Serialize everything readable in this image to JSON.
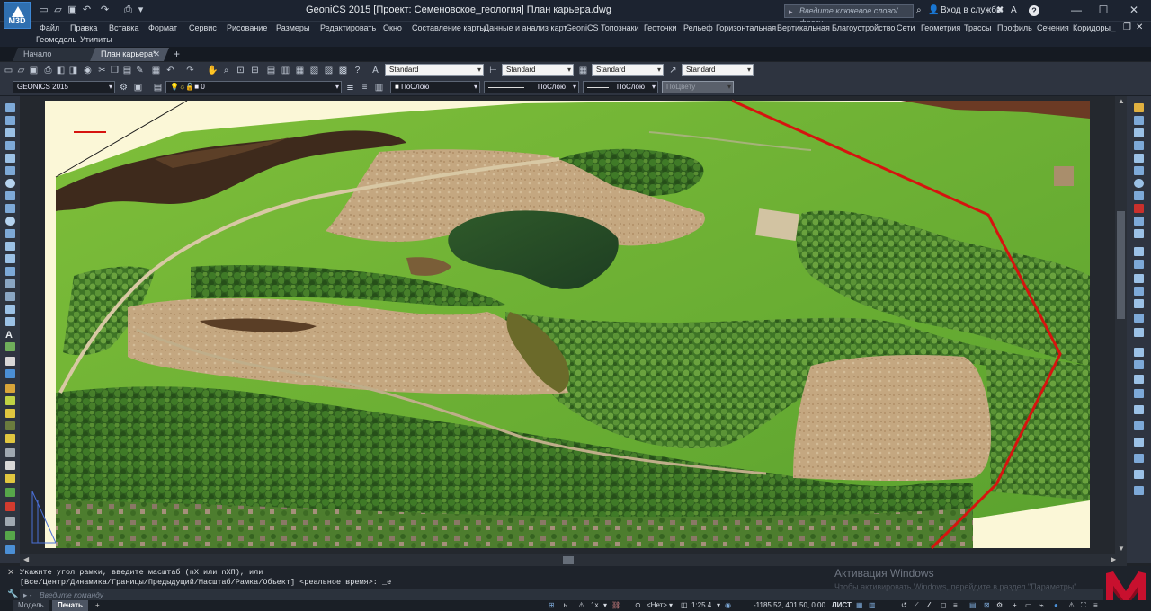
{
  "app": {
    "logo": "M3D",
    "window_title": "GeoniCS 2015 [Проект: Семеновское_геология]     План карьера.dwg",
    "search_placeholder": "Введите ключевое слово/фразу",
    "login_label": "Вход в службы",
    "help_icon": "?",
    "window_controls": [
      "—",
      "☐",
      "✕"
    ]
  },
  "menu": {
    "row1": [
      "Файл",
      "Правка",
      "Вставка",
      "Формат",
      "Сервис",
      "Рисование",
      "Размеры",
      "Редактировать",
      "Окно",
      "Составление карты",
      "Данные и анализ карт",
      "GeoniCS",
      "Топознаки",
      "Геоточки",
      "Рельеф",
      "Горизонтальная",
      "Вертикальная",
      "Благоустройство",
      "Сети",
      "Геометрия",
      "Трассы",
      "Профиль",
      "Сечения",
      "Коридоры"
    ],
    "row2": [
      "Геомодель",
      "Утилиты"
    ]
  },
  "tabs": [
    {
      "label": "Начало"
    },
    {
      "label": "План карьера*"
    },
    {
      "label": "+"
    }
  ],
  "toolbar": {
    "style1": "Standard",
    "style2": "Standard",
    "style3": "Standard",
    "style4": "Standard",
    "workspace": "GEONICS 2015",
    "layer": "0",
    "color": "ПоСлою",
    "linetype": "ПоСлою",
    "lineweight": "ПоСлою",
    "plotstyle": "ПоЦвету"
  },
  "command": {
    "line1": "Укажите угол рамки, введите масштаб (nX или nXП), или",
    "line2": "[Все/Центр/Динамика/Границы/Предыдущий/Масштаб/Рамка/Объект] <реальное время>: _e",
    "input_placeholder": "Введите команду"
  },
  "watermark": {
    "title": "Активация Windows",
    "subtitle": "Чтобы активировать Windows, перейдите в раздел \"Параметры\"."
  },
  "status": {
    "layout_tabs": [
      "Модель",
      "Печать",
      "+"
    ],
    "annotation_scale": "1x",
    "ucs": "<Нет>",
    "scale": "1:25.4",
    "coords": "-1185.52, 401.50, 0.00",
    "paper": "ЛИСТ"
  },
  "colors": {
    "boundary_line": "#d6140f",
    "accent": "#2f6fb0",
    "brand": "#c8102e"
  }
}
